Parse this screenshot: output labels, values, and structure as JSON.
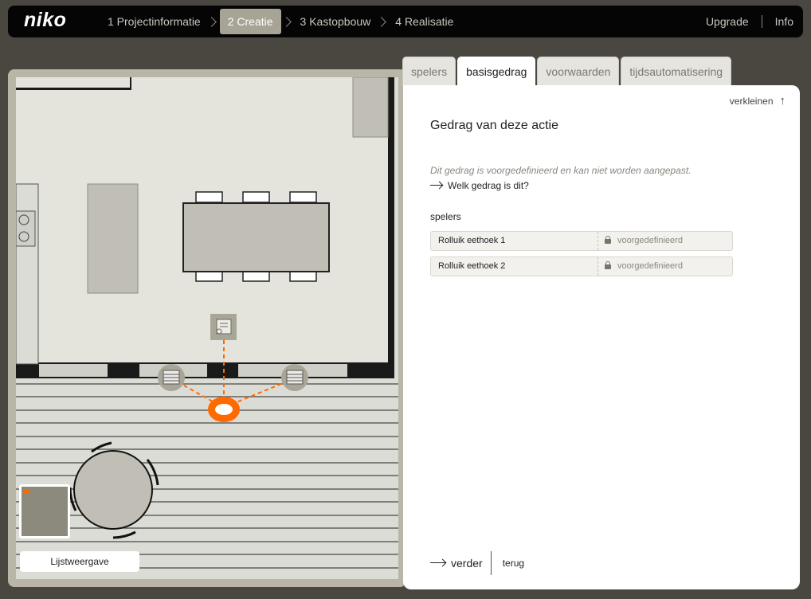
{
  "brand": {
    "logo": "niko"
  },
  "nav": {
    "steps": [
      {
        "label": "1 Projectinformatie"
      },
      {
        "label": "2 Creatie"
      },
      {
        "label": "3 Kastopbouw"
      },
      {
        "label": "4 Realisatie"
      }
    ],
    "active_step": 1,
    "right_links": [
      {
        "label": "Upgrade"
      },
      {
        "label": "Info"
      }
    ]
  },
  "floorplan": {
    "list_view_label": "Lijstweergave"
  },
  "panel": {
    "tabs": [
      {
        "label": "spelers"
      },
      {
        "label": "basisgedrag"
      },
      {
        "label": "voorwaarden"
      },
      {
        "label": "tijdsautomatisering"
      }
    ],
    "active_tab": 1,
    "collapse_label": "verkleinen",
    "title": "Gedrag van deze actie",
    "note": "Dit gedrag is voorgedefinieerd en kan niet worden aangepast.",
    "help_link": "Welk gedrag is dit?",
    "players_label": "spelers",
    "players": [
      {
        "name": "Rolluik eethoek 1",
        "status": "voorgedefinieerd"
      },
      {
        "name": "Rolluik eethoek 2",
        "status": "voorgedefinieerd"
      }
    ],
    "next_label": "verder",
    "back_label": "terug"
  },
  "colors": {
    "accent": "#ff6a00",
    "topbar": "#050505",
    "background": "#4a4740",
    "active_step": "#a8a495"
  }
}
